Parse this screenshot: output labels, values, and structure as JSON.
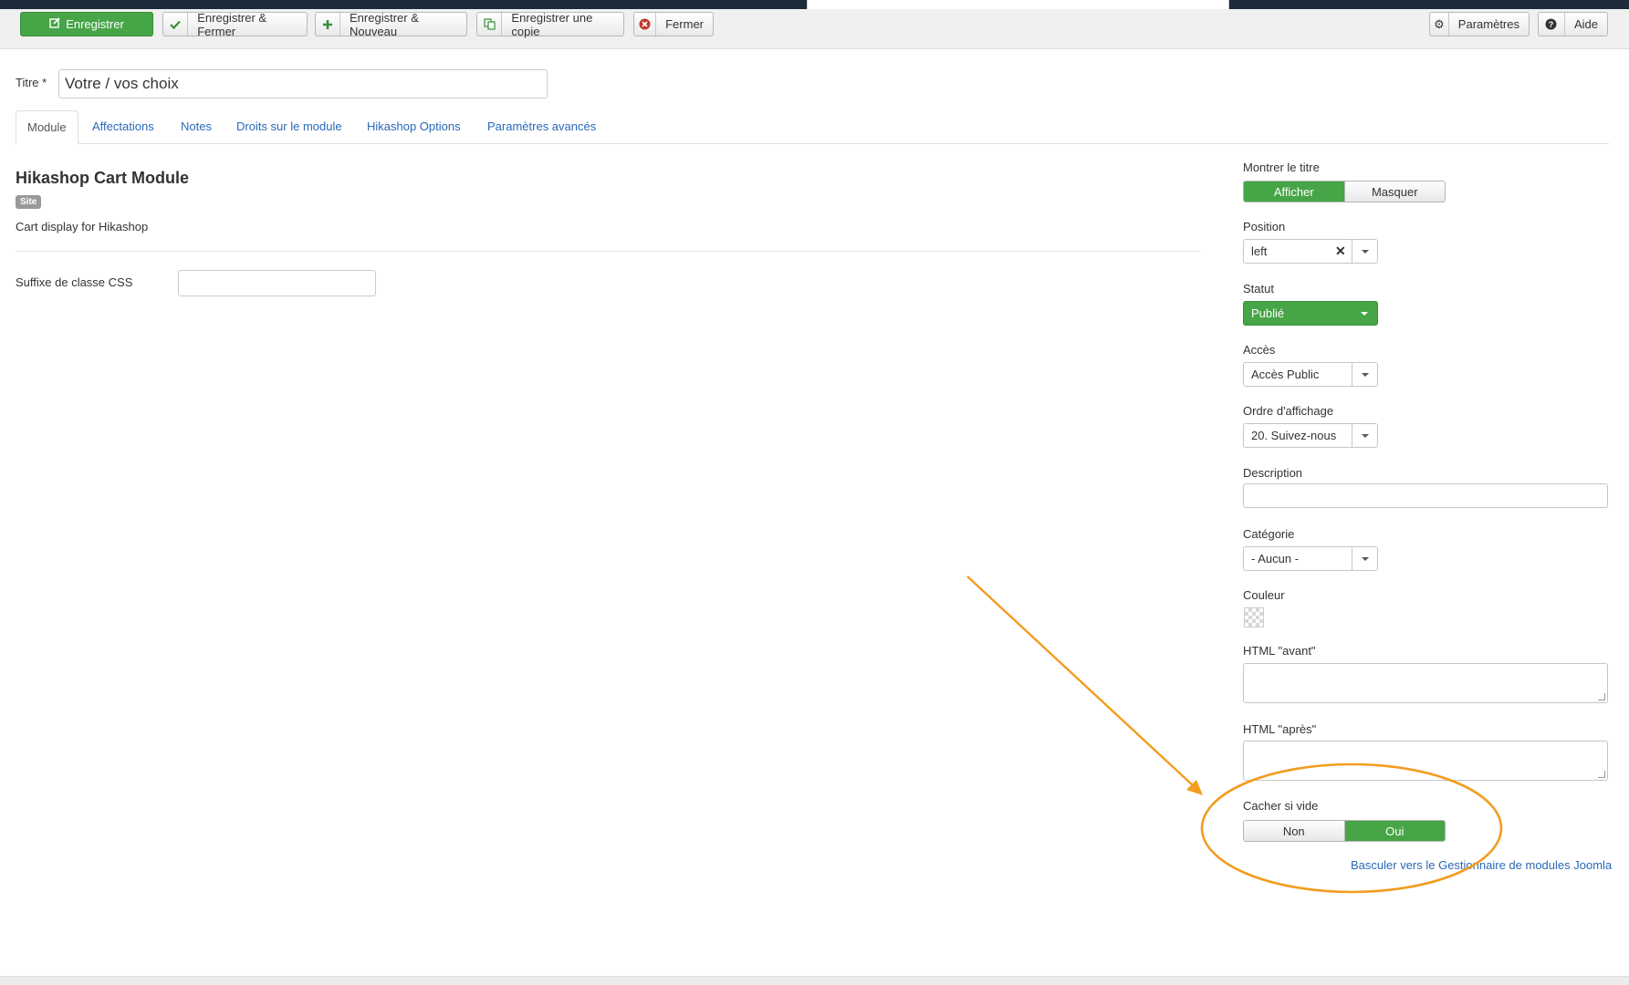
{
  "toolbar": {
    "save": "Enregistrer",
    "save_close": "Enregistrer & Fermer",
    "save_new": "Enregistrer & Nouveau",
    "save_copy": "Enregistrer une copie",
    "close": "Fermer",
    "options": "Paramètres",
    "help": "Aide"
  },
  "form": {
    "title_label": "Titre *",
    "title_value": "Votre / vos choix"
  },
  "tabs": [
    "Module",
    "Affectations",
    "Notes",
    "Droits sur le module",
    "Hikashop Options",
    "Paramètres avancés"
  ],
  "module": {
    "name": "Hikashop Cart Module",
    "badge": "Site",
    "description": "Cart display for Hikashop",
    "css_suffix_label": "Suffixe de classe CSS",
    "css_suffix_value": ""
  },
  "sidebar": {
    "show_title_label": "Montrer le titre",
    "show_title_options": [
      "Afficher",
      "Masquer"
    ],
    "show_title_selected": "Afficher",
    "position_label": "Position",
    "position_value": "left",
    "status_label": "Statut",
    "status_value": "Publié",
    "access_label": "Accès",
    "access_value": "Accès Public",
    "ordering_label": "Ordre d'affichage",
    "ordering_value": "20. Suivez-nous",
    "description_label": "Description",
    "description_value": "",
    "category_label": "Catégorie",
    "category_value": "- Aucun -",
    "color_label": "Couleur",
    "html_before_label": "HTML \"avant\"",
    "html_after_label": "HTML \"après\"",
    "hide_empty_label": "Cacher si vide",
    "hide_empty_options": [
      "Non",
      "Oui"
    ],
    "hide_empty_selected": "Oui",
    "switch_link": "Basculer vers le Gestionnaire de modules Joomla"
  },
  "colors": {
    "primary_green": "#46a546",
    "link_blue": "#2a69b8",
    "annotation_orange": "#f39c1f"
  }
}
